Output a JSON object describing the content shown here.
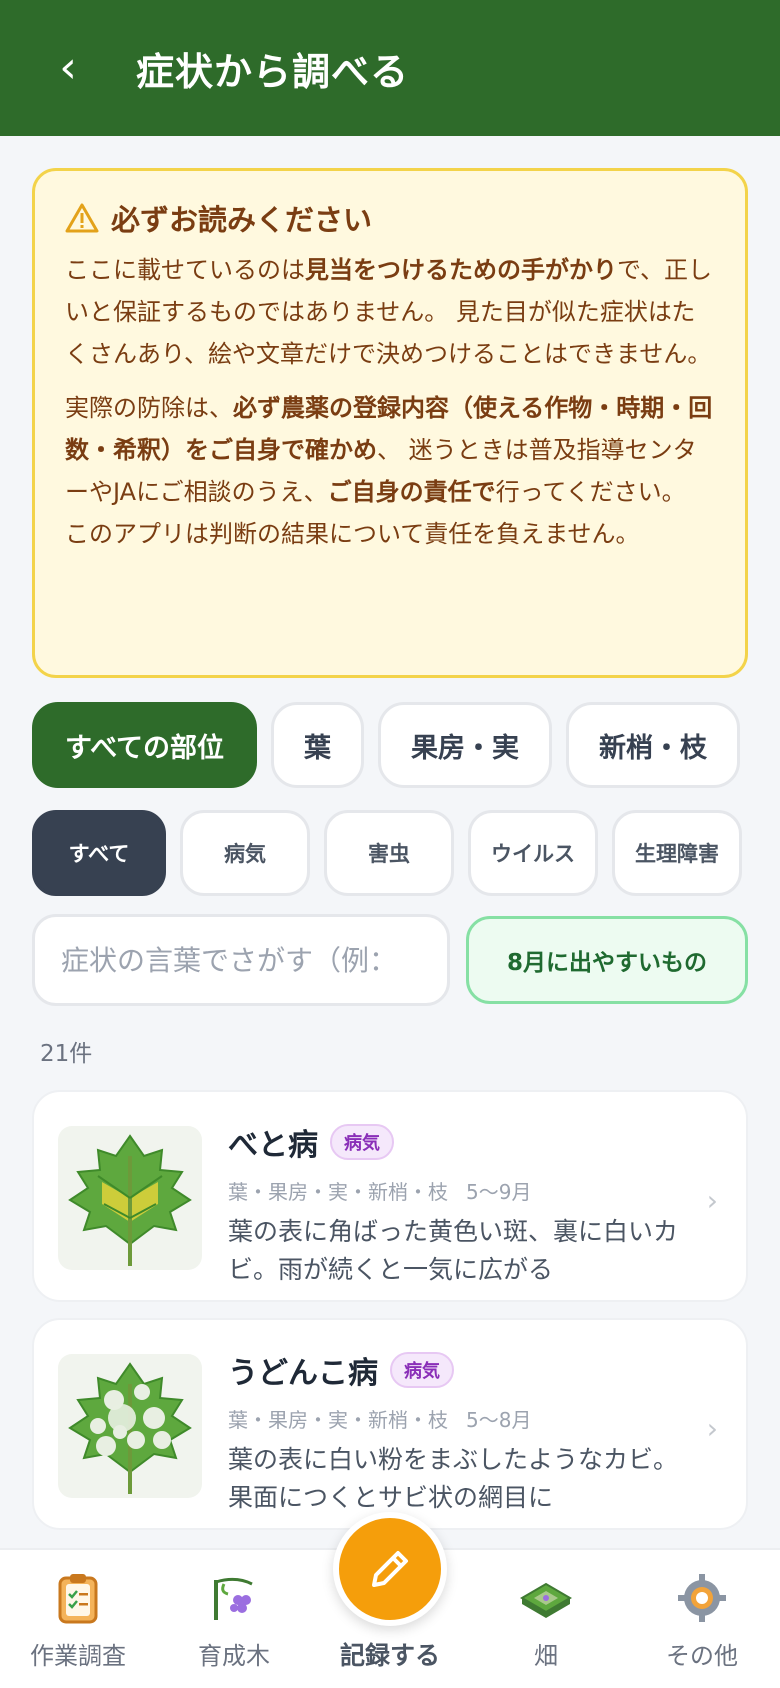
{
  "header": {
    "back_icon": "‹",
    "title": "症状から調べる"
  },
  "notice": {
    "title": "必ずお読みください",
    "p1_a": "ここに載せているのは",
    "p1_b": "見当をつけるための手がかり",
    "p1_c": "で、正しいと保証するものではありません。 見た目が似た症状はたくさんあり、絵や文章だけで決めつけることはできません。",
    "p2_a": "実際の防除は、",
    "p2_b": "必ず農薬の登録内容（使える作物・時期・回数・希釈）をご自身で確かめ",
    "p2_c": "、 迷うときは普及指導センターやJAにご相談のうえ、",
    "p2_d": "ご自身の責任で",
    "p2_e": "行ってください。 このアプリは判断の結果について責任を負えません。"
  },
  "part_filters": [
    "すべての部位",
    "葉",
    "果房・実",
    "新梢・枝"
  ],
  "category_filters": [
    "すべて",
    "病気",
    "害虫",
    "ウイルス",
    "生理障害"
  ],
  "search": {
    "placeholder": "症状の言葉でさがす（例：",
    "value": ""
  },
  "season_button": "8月に出やすいもの",
  "result_count": "21件",
  "results": [
    {
      "title": "べと病",
      "badge": "病気",
      "parts": "葉・果房・実・新梢・枝",
      "season": "5〜9月",
      "description": "葉の表に角ばった黄色い斑、裏に白いカビ。雨が続くと一気に広がる"
    },
    {
      "title": "うどんこ病",
      "badge": "病気",
      "parts": "葉・果房・実・新梢・枝",
      "season": "5〜8月",
      "description": "葉の表に白い粉をまぶしたようなカビ。果面につくとサビ状の網目に"
    }
  ],
  "chevron": "›",
  "bottom_nav": {
    "items": [
      "作業調査",
      "育成木",
      "記録する",
      "畑",
      "その他"
    ]
  },
  "colors": {
    "header": "#2e6b2a",
    "accent": "#f59e0b",
    "notice_bg": "#fff9df",
    "notice_border": "#f3d34a"
  }
}
